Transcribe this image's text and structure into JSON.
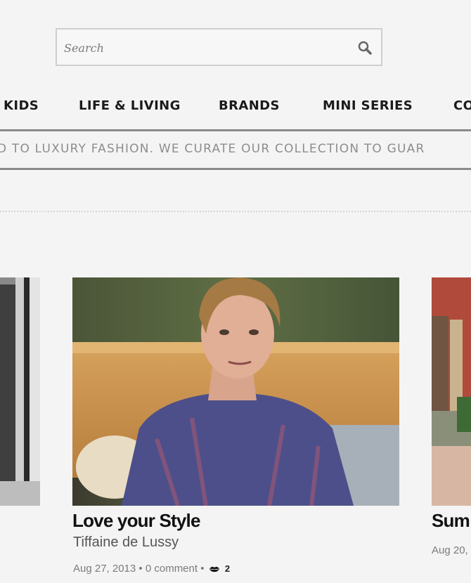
{
  "search": {
    "placeholder": "Search"
  },
  "nav": {
    "items": [
      {
        "label": "KIDS"
      },
      {
        "label": "LIFE & LIVING"
      },
      {
        "label": "BRANDS"
      },
      {
        "label": "MINI SERIES"
      },
      {
        "label": "CO"
      }
    ]
  },
  "tagline": "D TO LUXURY FASHION. WE CURATE OUR COLLECTION TO GUAR",
  "cards": {
    "main": {
      "title": "Love your Style",
      "author": "Tiffaine de Lussy",
      "date": "Aug 27, 2013",
      "comments": "0 comment",
      "likes": "2"
    },
    "right": {
      "title": "Sum",
      "date": "Aug 20,"
    }
  },
  "icons": {
    "search": "search-icon",
    "likes": "lips-icon"
  }
}
